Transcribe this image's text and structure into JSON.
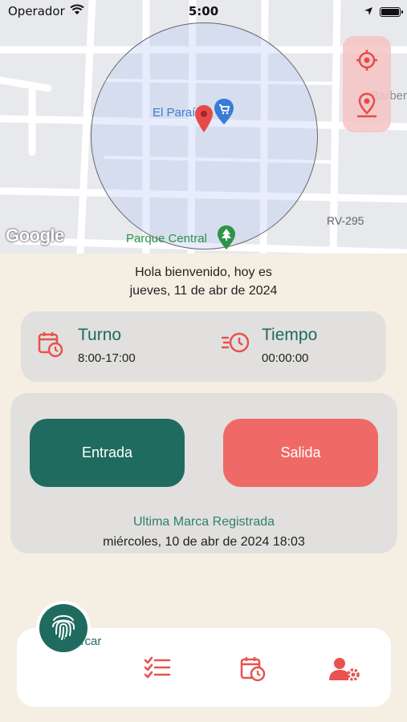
{
  "status_bar": {
    "carrier": "Operador",
    "time": "5:00"
  },
  "map": {
    "labels": {
      "place_1": "El Paraíso",
      "place_2": "Parque Central",
      "road": "RV-295",
      "shop": "Barber",
      "logo": "Google"
    }
  },
  "greeting": {
    "line1": "Hola bienvenido, hoy es",
    "line2": "jueves, 11 de abr de 2024"
  },
  "shift": {
    "title": "Turno",
    "value": "8:00-17:00"
  },
  "timer": {
    "title": "Tiempo",
    "value": "00:00:00"
  },
  "actions": {
    "entry_label": "Entrada",
    "exit_label": "Salida",
    "last_title": "Ultima Marca Registrada",
    "last_date": "miércoles, 10 de abr de 2024 18:03"
  },
  "nav": {
    "mark_label": "Marcar"
  },
  "colors": {
    "primary": "#1f6b60",
    "accent": "#ef6a67",
    "background": "#f5efe3",
    "card": "#e1e0de"
  }
}
